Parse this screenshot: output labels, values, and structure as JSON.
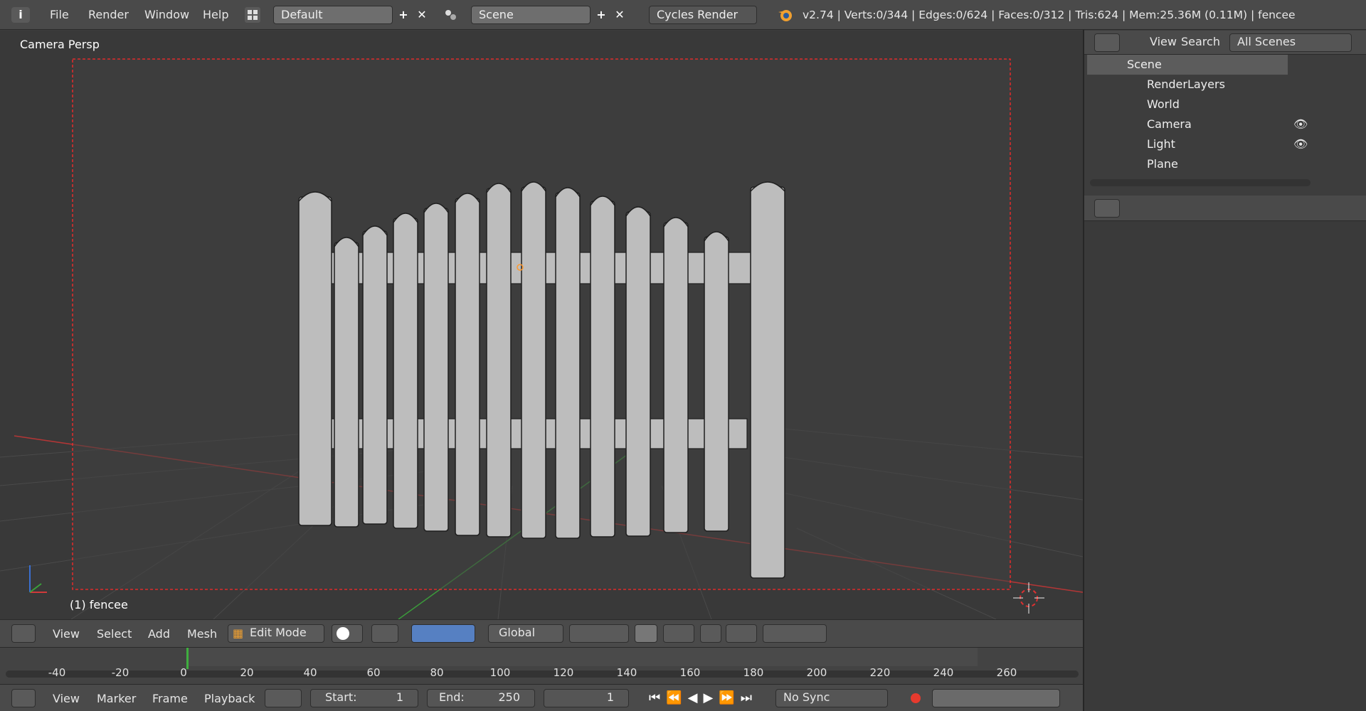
{
  "topbar": {
    "menus": [
      "File",
      "Render",
      "Window",
      "Help"
    ],
    "layout": "Default",
    "scene": "Scene",
    "engine": "Cycles Render",
    "status": "v2.74 | Verts:0/344 | Edges:0/624 | Faces:0/312 | Tris:624 | Mem:25.36M (0.11M) | fencee"
  },
  "viewport": {
    "label": "Camera Persp",
    "object_label": "(1) fencee"
  },
  "header3d": {
    "menus": [
      "View",
      "Select",
      "Add",
      "Mesh"
    ],
    "mode": "Edit Mode",
    "orientation": "Global"
  },
  "timeline": {
    "ticks": [
      "-40",
      "-20",
      "0",
      "20",
      "40",
      "60",
      "80",
      "100",
      "120",
      "140",
      "160",
      "180",
      "200",
      "220",
      "240",
      "260"
    ],
    "menus": [
      "View",
      "Marker",
      "Frame",
      "Playback"
    ],
    "start_label": "Start:",
    "start_value": "1",
    "end_label": "End:",
    "end_value": "250",
    "current_frame": "1",
    "sync": "No Sync"
  },
  "outliner": {
    "menus": [
      "View",
      "Search"
    ],
    "filter": "All Scenes",
    "items": [
      {
        "label": "Scene"
      },
      {
        "label": "RenderLayers"
      },
      {
        "label": "World"
      },
      {
        "label": "Camera"
      },
      {
        "label": "Light"
      },
      {
        "label": "Plane"
      }
    ]
  },
  "colors": {
    "accent_select": "#5680c2",
    "camera_frame": "#ff2828",
    "x_axis": "#b33636",
    "y_axis": "#3b9a3b",
    "current_frame": "#3fae3f",
    "record": "#e63a2e"
  },
  "icons": [
    "info-icon",
    "layout-icon",
    "scene-icon",
    "blender-logo-icon",
    "edit-mode-icon",
    "eye-icon",
    "cursor-icon",
    "render-icon"
  ]
}
